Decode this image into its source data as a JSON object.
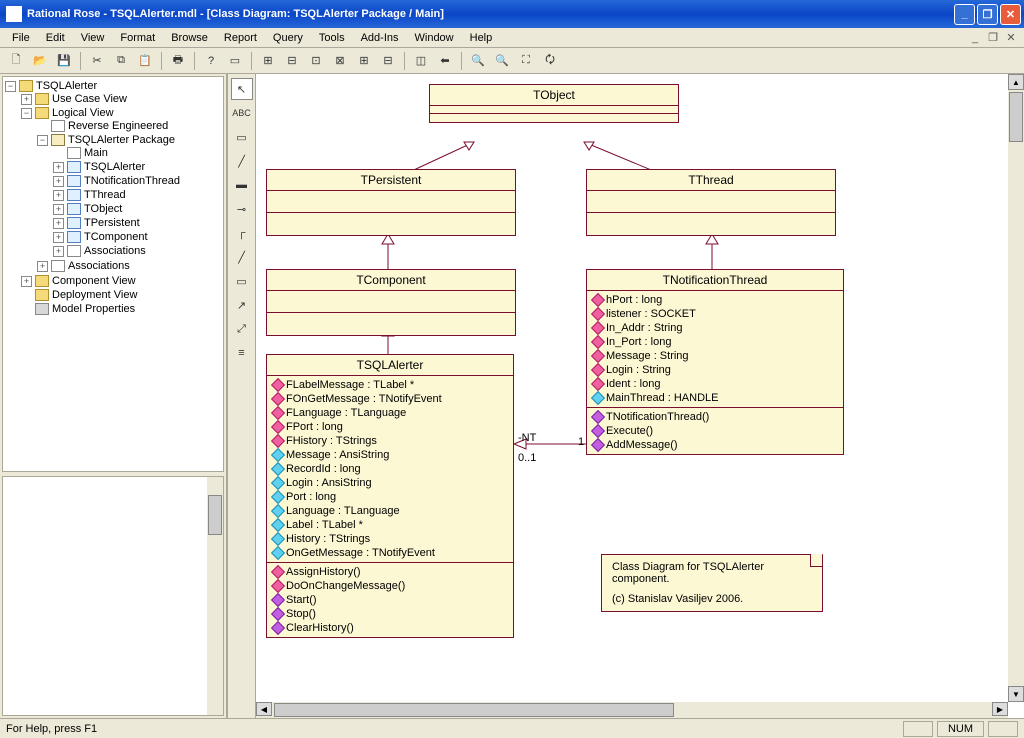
{
  "title": "Rational Rose - TSQLAlerter.mdl - [Class Diagram: TSQLAlerter Package / Main]",
  "menu": [
    "File",
    "Edit",
    "View",
    "Format",
    "Browse",
    "Report",
    "Query",
    "Tools",
    "Add-Ins",
    "Window",
    "Help"
  ],
  "tree": {
    "root": "TSQLAlerter",
    "useCase": "Use Case View",
    "logical": "Logical View",
    "reverse": "Reverse Engineered",
    "pkg": "TSQLAlerter Package",
    "main": "Main",
    "tsqlalerter": "TSQLAlerter",
    "tnotif": "TNotificationThread",
    "tthread": "TThread",
    "tobject": "TObject",
    "tpersistent": "TPersistent",
    "tcomponent": "TComponent",
    "assoc1": "Associations",
    "assoc2": "Associations",
    "component": "Component View",
    "deploy": "Deployment View",
    "model": "Model Properties"
  },
  "classes": {
    "tobject": {
      "name": "TObject"
    },
    "tpersistent": {
      "name": "TPersistent"
    },
    "tthread": {
      "name": "TThread"
    },
    "tcomponent": {
      "name": "TComponent"
    },
    "tnotif": {
      "name": "TNotificationThread",
      "attrs": [
        {
          "v": "priv",
          "t": "hPort : long"
        },
        {
          "v": "priv",
          "t": "listener : SOCKET"
        },
        {
          "v": "priv",
          "t": "In_Addr : String"
        },
        {
          "v": "priv",
          "t": "In_Port : long"
        },
        {
          "v": "priv",
          "t": "Message : String"
        },
        {
          "v": "priv",
          "t": "Login : String"
        },
        {
          "v": "priv",
          "t": "Ident : long"
        },
        {
          "v": "prot",
          "t": "MainThread : HANDLE"
        }
      ],
      "ops": [
        {
          "v": "pub",
          "t": "TNotificationThread()"
        },
        {
          "v": "pub",
          "t": "Execute()"
        },
        {
          "v": "pub",
          "t": "AddMessage()"
        }
      ]
    },
    "tsqla": {
      "name": "TSQLAlerter",
      "attrs": [
        {
          "v": "priv",
          "t": "FLabelMessage : TLabel *"
        },
        {
          "v": "priv",
          "t": "FOnGetMessage : TNotifyEvent"
        },
        {
          "v": "priv",
          "t": "FLanguage : TLanguage"
        },
        {
          "v": "priv",
          "t": "FPort : long"
        },
        {
          "v": "priv",
          "t": "FHistory : TStrings"
        },
        {
          "v": "prot",
          "t": "Message : AnsiString"
        },
        {
          "v": "prot",
          "t": "RecordId : long"
        },
        {
          "v": "prot",
          "t": "Login : AnsiString"
        },
        {
          "v": "prot",
          "t": "Port : long"
        },
        {
          "v": "prot",
          "t": "Language : TLanguage"
        },
        {
          "v": "prot",
          "t": "Label : TLabel *"
        },
        {
          "v": "prot",
          "t": "History : TStrings"
        },
        {
          "v": "prot",
          "t": "OnGetMessage : TNotifyEvent"
        }
      ],
      "ops": [
        {
          "v": "priv",
          "t": "AssignHistory()"
        },
        {
          "v": "priv",
          "t": "DoOnChangeMessage()"
        },
        {
          "v": "pub",
          "t": "Start()"
        },
        {
          "v": "pub",
          "t": "Stop()"
        },
        {
          "v": "pub",
          "t": "ClearHistory()"
        }
      ]
    }
  },
  "mult": {
    "a": "-NT",
    "b": "0..1",
    "c": "1"
  },
  "note": {
    "l1": "Class Diagram for TSQLAlerter",
    "l2": "component.",
    "l3": "(c) Stanislav Vasiljev 2006."
  },
  "status": {
    "help": "For Help, press F1",
    "num": "NUM"
  }
}
